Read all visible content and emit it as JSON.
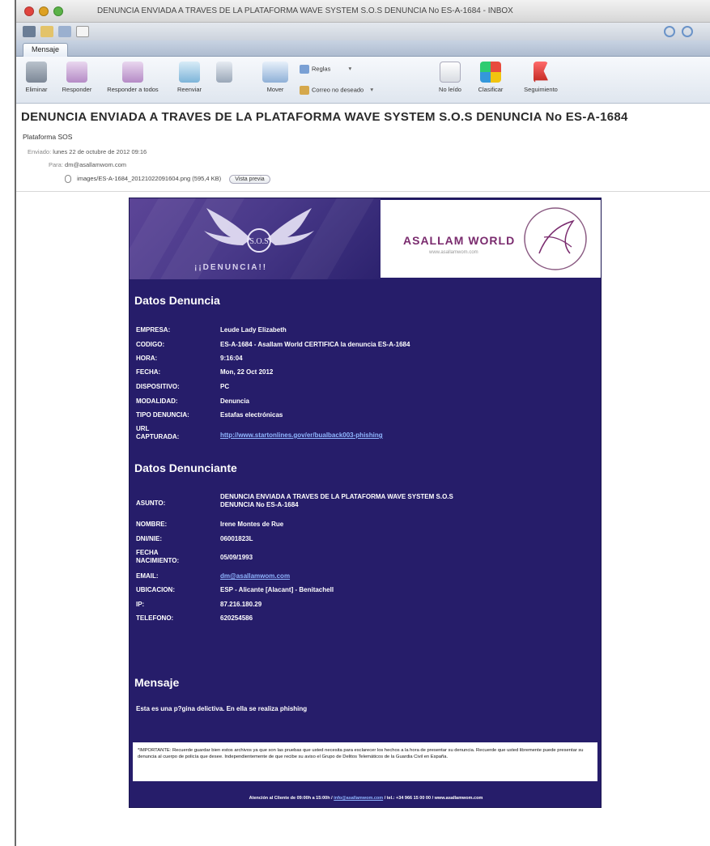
{
  "window": {
    "title": "DENUNCIA ENVIADA A TRAVES DE LA PLATAFORMA WAVE SYSTEM S.O.S DENUNCIA No ES-A-1684 - INBOX"
  },
  "tabs": [
    {
      "label": "Mensaje"
    }
  ],
  "toolbar": {
    "delete_label": "Eliminar",
    "reply_label": "Responder",
    "reply_all_label": "Responder a todos",
    "forward_label": "Reenviar",
    "move_label": "Mover",
    "rules_label": "Reglas",
    "junk_label": "Correo no deseado",
    "unread_label": "No leído",
    "categorize_label": "Clasificar",
    "followup_label": "Seguimiento"
  },
  "message": {
    "subject": "DENUNCIA ENVIADA A TRAVES DE LA PLATAFORMA WAVE SYSTEM S.O.S DENUNCIA No ES-A-1684",
    "sender": "Plataforma SOS",
    "sent_label": "Enviado:",
    "sent_value": "lunes 22 de octubre de 2012 09:16",
    "to_label": "Para:",
    "to_value": "dm@asallamwom.com",
    "attachment_name": "images/ES-A-1684_20121022091604.png (595,4 KB)",
    "preview_button": "Vista previa"
  },
  "email_body": {
    "banner_left_text": "¡¡DENUNCIA!!",
    "brand_name": "ASALLAM WORLD",
    "brand_url": "www.asallamwom.com",
    "section_complaint_title": "Datos Denuncia",
    "complaint_rows": [
      {
        "key": "EMPRESA:",
        "value": "Leude Lady Elizabeth"
      },
      {
        "key": "CODIGO:",
        "value": "ES-A-1684 - Asallam World CERTIFICA la denuncia ES-A-1684"
      },
      {
        "key": "HORA:",
        "value": "9:16:04"
      },
      {
        "key": "FECHA:",
        "value": "Mon, 22 Oct 2012"
      },
      {
        "key": "DISPOSITIVO:",
        "value": "PC"
      },
      {
        "key": "MODALIDAD:",
        "value": "Denuncia"
      },
      {
        "key": "TIPO DENUNCIA:",
        "value": "Estafas electrónicas"
      },
      {
        "key": "URL CAPTURADA:",
        "value": "http://www.startonlines.gov/er/bualback003-phishing"
      }
    ],
    "section_complainant_title": "Datos Denunciante",
    "complainant_rows": [
      {
        "key": "ASUNTO:",
        "value": "DENUNCIA ENVIADA A TRAVES DE LA PLATAFORMA WAVE SYSTEM S.O.S DENUNCIA No ES-A-1684"
      },
      {
        "key": "NOMBRE:",
        "value": "Irene Montes de Rue"
      },
      {
        "key": "DNI/NIE:",
        "value": "06001823L"
      },
      {
        "key": "FECHA NACIMIENTO:",
        "value": "05/09/1993"
      },
      {
        "key": "EMAIL:",
        "value": "dm@asallamwom.com"
      },
      {
        "key": "UBICACION:",
        "value": "ESP - Alicante [Alacant] - Benitachell"
      },
      {
        "key": "IP:",
        "value": "87.216.180.29"
      },
      {
        "key": "TELEFONO:",
        "value": "620254586"
      }
    ],
    "section_message_title": "Mensaje",
    "message_text": "Esta es una p?gina delictiva. En ella se realiza phishing",
    "important_text": "*IMPORTANTE: Recuerde guardar bien estos archivos ya que son las pruebas que usted necesita para esclarecer los hechos a la hora de presentar su denuncia. Recuerde que usted libremente puede presentar su denuncia al cuerpo de policía que desee. Independientemente de que recibe su aviso el Grupo de Delitos Telemáticos de la Guardia Civil en España.",
    "footer_prefix": "Atención al Cliente de 09:00h a 15:00h / ",
    "footer_link": "info@asallamwom.com",
    "footer_suffix": " / tel.: +34 966 15 00 00 / www.asallamwom.com"
  },
  "colors": {
    "email_bg": "#261d6a",
    "link": "#8fb6ff",
    "brand": "#7a2b6e"
  }
}
